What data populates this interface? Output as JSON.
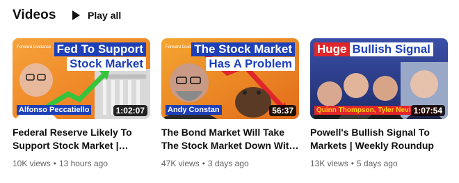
{
  "section": {
    "title": "Videos",
    "play_all": "Play all"
  },
  "videos": [
    {
      "thumb_line1": "Fed To Support",
      "thumb_line2": "Stock Market",
      "name_tag": "Alfonso Peccatiello",
      "duration": "1:02:07",
      "title_line1": "Federal Reserve Likely To",
      "title_line2": "Support Stock Market |…",
      "views": "10K views",
      "age": "13 hours ago"
    },
    {
      "thumb_line1": "The Stock Market",
      "thumb_line2": "Has A Problem",
      "name_tag": "Andy Constan",
      "duration": "56:37",
      "title_line1": "The Bond Market Will Take",
      "title_line2": "The Stock Market Down Wit…",
      "views": "47K views",
      "age": "3 days ago"
    },
    {
      "thumb_word1": "Huge",
      "thumb_word2": "Bullish Signal",
      "name_tag": "Quinn Thompson, Tyler Neville, Felix",
      "duration": "1:07:54",
      "title_line1": "Powell's Bullish Signal To",
      "title_line2": "Markets | Weekly Roundup",
      "views": "13K views",
      "age": "5 days ago"
    }
  ],
  "colors": {
    "accent_red": "#e0262a",
    "banner_blue": "#1d3fb8",
    "banner_yellow": "#ffd400",
    "orange_bg": "#f28a1e",
    "meta_gray": "#606060"
  }
}
